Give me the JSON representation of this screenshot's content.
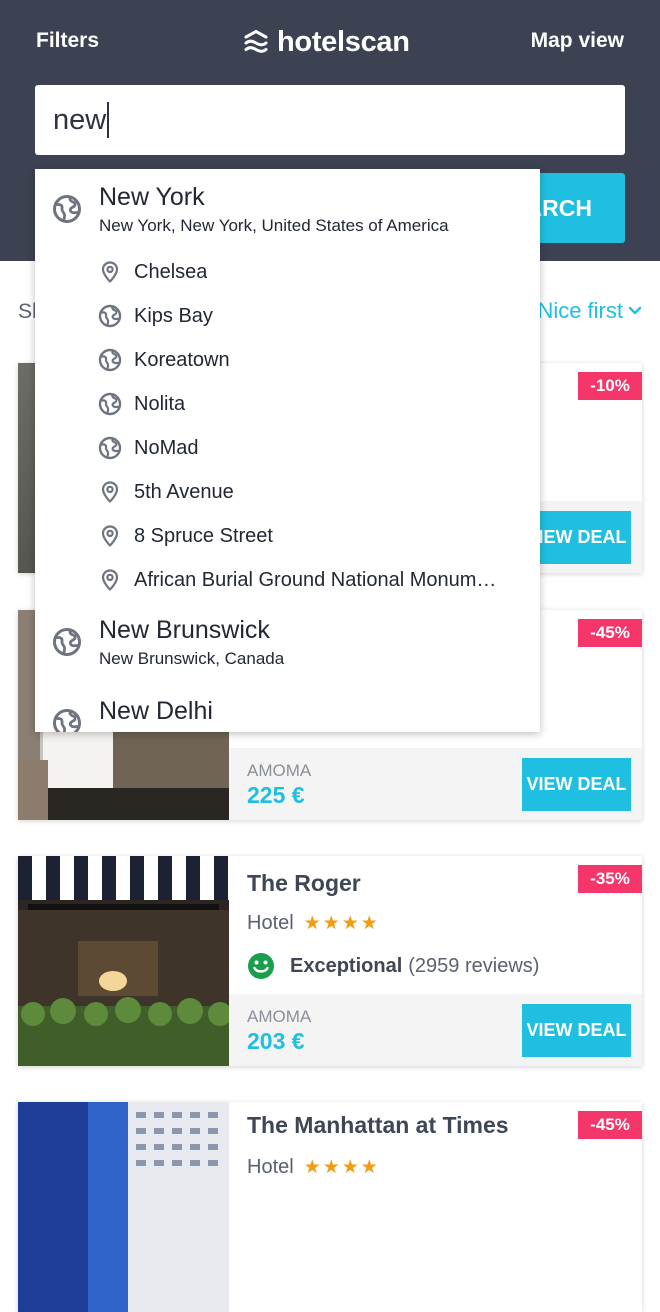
{
  "header": {
    "filters_label": "Filters",
    "brand": "hotelscan",
    "map_view_label": "Map view"
  },
  "search": {
    "value": "new",
    "button_label": "SEARCH"
  },
  "sort": {
    "left_partial": "Sh",
    "right_label": "Nice first"
  },
  "autocomplete": {
    "groups": [
      {
        "title": "New York",
        "subtitle": "New York, New York, United States of America",
        "icon": "globe-icon",
        "children": [
          {
            "label": "Chelsea",
            "icon": "pin-icon"
          },
          {
            "label": "Kips Bay",
            "icon": "globe-icon"
          },
          {
            "label": "Koreatown",
            "icon": "globe-icon"
          },
          {
            "label": "Nolita",
            "icon": "globe-icon"
          },
          {
            "label": "NoMad",
            "icon": "globe-icon"
          },
          {
            "label": "5th Avenue",
            "icon": "pin-icon"
          },
          {
            "label": "8 Spruce Street",
            "icon": "pin-icon"
          },
          {
            "label": "African Burial Ground National Monum…",
            "icon": "pin-icon"
          }
        ]
      },
      {
        "title": "New Brunswick",
        "subtitle": "New Brunswick, Canada",
        "icon": "globe-icon"
      },
      {
        "title": "New Delhi",
        "icon": "globe-icon"
      }
    ]
  },
  "hotels": [
    {
      "discount": "-10%",
      "view_deal_label": "VIEW DEAL"
    },
    {
      "discount": "-45%",
      "provider": "AMOMA",
      "price": "225 €",
      "view_deal_label": "VIEW DEAL"
    },
    {
      "name": "The Roger",
      "type": "Hotel",
      "stars": "★★★★",
      "star_count": 4,
      "rating_word": "Exceptional",
      "reviews": "(2959 reviews)",
      "discount": "-35%",
      "provider": "AMOMA",
      "price": "203 €",
      "view_deal_label": "VIEW DEAL"
    },
    {
      "name": "The Manhattan at Times",
      "type": "Hotel",
      "stars": "★★★★",
      "star_count": 4,
      "discount": "-45%"
    }
  ],
  "colors": {
    "header_bg": "#3c4252",
    "accent": "#1fbfe2",
    "discount": "#f4366b",
    "stars": "#f39c12",
    "rating_green": "#1a9e4b"
  }
}
